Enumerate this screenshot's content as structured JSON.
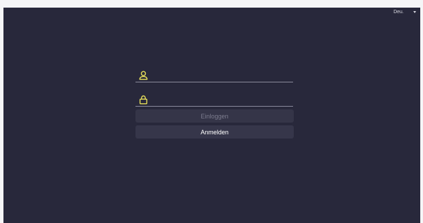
{
  "language": {
    "selected": "Deu."
  },
  "login_form": {
    "username": {
      "value": "",
      "placeholder": ""
    },
    "password": {
      "value": "",
      "placeholder": ""
    },
    "login_button": "Einloggen",
    "register_button": "Anmelden"
  },
  "colors": {
    "background": "#28283b",
    "accent_icon": "#e8e05a",
    "button_bg": "#353548",
    "disabled_text": "#7c7c8e"
  },
  "icons": {
    "username": "user-icon",
    "password": "lock-icon",
    "language_dropdown": "caret-down-icon"
  }
}
